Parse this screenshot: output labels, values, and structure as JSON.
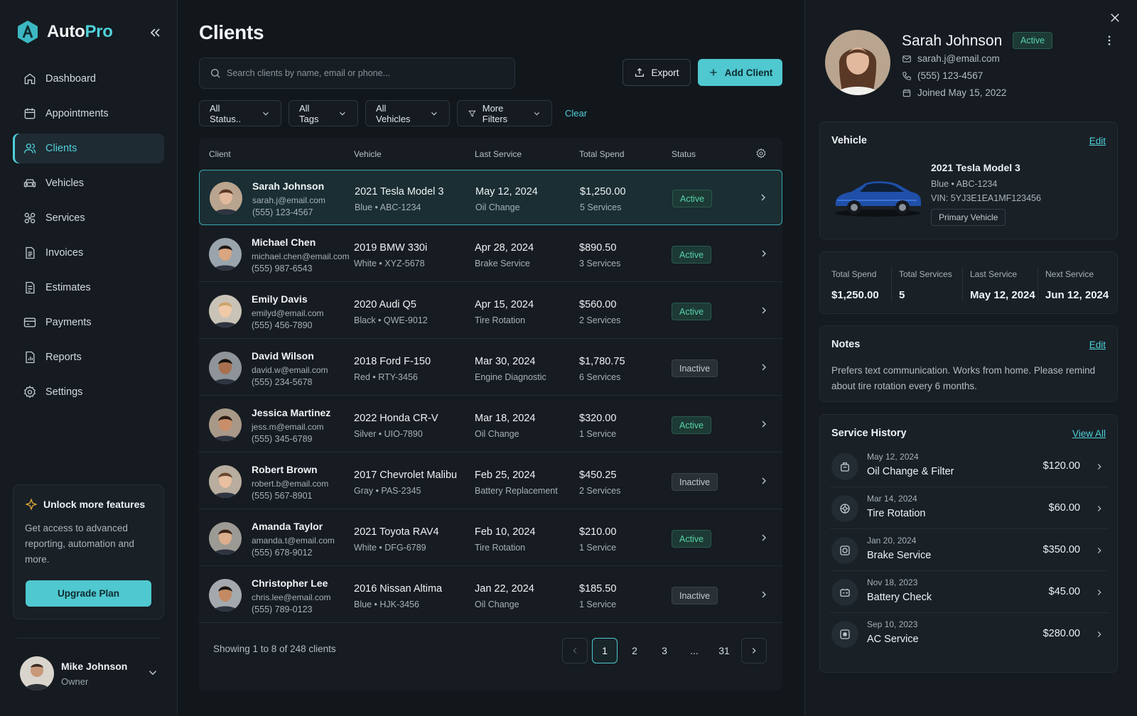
{
  "app": {
    "name_main": "Auto",
    "name_accent": "Pro"
  },
  "nav": [
    {
      "label": "Dashboard",
      "icon": "home-icon",
      "active": false
    },
    {
      "label": "Appointments",
      "icon": "calendar-icon",
      "active": false
    },
    {
      "label": "Clients",
      "icon": "users-icon",
      "active": true
    },
    {
      "label": "Vehicles",
      "icon": "car-icon",
      "active": false
    },
    {
      "label": "Services",
      "icon": "services-icon",
      "active": false
    },
    {
      "label": "Invoices",
      "icon": "invoice-icon",
      "active": false
    },
    {
      "label": "Estimates",
      "icon": "estimate-icon",
      "active": false
    },
    {
      "label": "Payments",
      "icon": "payment-icon",
      "active": false
    },
    {
      "label": "Reports",
      "icon": "report-icon",
      "active": false
    },
    {
      "label": "Settings",
      "icon": "gear-icon",
      "active": false
    }
  ],
  "upgrade": {
    "title": "Unlock more features",
    "description": "Get access to advanced reporting, automation and more.",
    "button": "Upgrade Plan"
  },
  "user": {
    "name": "Mike Johnson",
    "role": "Owner"
  },
  "page": {
    "title": "Clients"
  },
  "search": {
    "placeholder": "Search clients by name, email or phone..."
  },
  "actions": {
    "export": "Export",
    "add": "Add Client"
  },
  "filters": {
    "status": "All Status..",
    "tags": "All Tags",
    "vehicles": "All Vehicles",
    "more": "More Filters",
    "clear": "Clear"
  },
  "table": {
    "columns": {
      "client": "Client",
      "vehicle": "Vehicle",
      "last_service": "Last Service",
      "total_spend": "Total Spend",
      "status": "Status"
    },
    "rows": [
      {
        "name": "Sarah Johnson",
        "email": "sarah.j@email.com",
        "phone": "(555) 123-4567",
        "vehicle": "2021 Tesla Model 3",
        "color": "Blue",
        "plate": "ABC-1234",
        "last_date": "May 12, 2024",
        "last_type": "Oil Change",
        "spend": "$1,250.00",
        "services": "5 Services",
        "status": "Active"
      },
      {
        "name": "Michael Chen",
        "email": "michael.chen@email.com",
        "phone": "(555) 987-6543",
        "vehicle": "2019 BMW 330i",
        "color": "White",
        "plate": "XYZ-5678",
        "last_date": "Apr 28, 2024",
        "last_type": "Brake Service",
        "spend": "$890.50",
        "services": "3 Services",
        "status": "Active"
      },
      {
        "name": "Emily Davis",
        "email": "emilyd@email.com",
        "phone": "(555) 456-7890",
        "vehicle": "2020 Audi Q5",
        "color": "Black",
        "plate": "QWE-9012",
        "last_date": "Apr 15, 2024",
        "last_type": "Tire Rotation",
        "spend": "$560.00",
        "services": "2 Services",
        "status": "Active"
      },
      {
        "name": "David Wilson",
        "email": "david.w@email.com",
        "phone": "(555) 234-5678",
        "vehicle": "2018 Ford F-150",
        "color": "Red",
        "plate": "RTY-3456",
        "last_date": "Mar 30, 2024",
        "last_type": "Engine Diagnostic",
        "spend": "$1,780.75",
        "services": "6 Services",
        "status": "Inactive"
      },
      {
        "name": "Jessica Martinez",
        "email": "jess.m@email.com",
        "phone": "(555) 345-6789",
        "vehicle": "2022 Honda CR-V",
        "color": "Silver",
        "plate": "UIO-7890",
        "last_date": "Mar 18, 2024",
        "last_type": "Oil Change",
        "spend": "$320.00",
        "services": "1 Service",
        "status": "Active"
      },
      {
        "name": "Robert Brown",
        "email": "robert.b@email.com",
        "phone": "(555) 567-8901",
        "vehicle": "2017 Chevrolet Malibu",
        "color": "Gray",
        "plate": "PAS-2345",
        "last_date": "Feb 25, 2024",
        "last_type": "Battery Replacement",
        "spend": "$450.25",
        "services": "2 Services",
        "status": "Inactive"
      },
      {
        "name": "Amanda Taylor",
        "email": "amanda.t@email.com",
        "phone": "(555) 678-9012",
        "vehicle": "2021 Toyota RAV4",
        "color": "White",
        "plate": "DFG-6789",
        "last_date": "Feb 10, 2024",
        "last_type": "Tire Rotation",
        "spend": "$210.00",
        "services": "1 Service",
        "status": "Active"
      },
      {
        "name": "Christopher Lee",
        "email": "chris.lee@email.com",
        "phone": "(555) 789-0123",
        "vehicle": "2016 Nissan Altima",
        "color": "Blue",
        "plate": "HJK-3456",
        "last_date": "Jan 22, 2024",
        "last_type": "Oil Change",
        "spend": "$185.50",
        "services": "1 Service",
        "status": "Inactive"
      }
    ],
    "footer": "Showing 1 to 8 of 248 clients",
    "pages": [
      "1",
      "2",
      "3",
      "...",
      "31"
    ]
  },
  "panel": {
    "name": "Sarah Johnson",
    "status": "Active",
    "email": "sarah.j@email.com",
    "phone": "(555) 123-4567",
    "joined": "Joined May 15, 2022",
    "vehicle": {
      "title": "Vehicle",
      "edit": "Edit",
      "model": "2021 Tesla Model 3",
      "sub": "Blue  •  ABC-1234",
      "vin": "VIN: 5YJ3E1EA1MF123456",
      "tag": "Primary Vehicle"
    },
    "stats": [
      {
        "label": "Total Spend",
        "value": "$1,250.00"
      },
      {
        "label": "Total Services",
        "value": "5"
      },
      {
        "label": "Last Service",
        "value": "May 12, 2024"
      },
      {
        "label": "Next Service",
        "value": "Jun 12, 2024"
      }
    ],
    "notes": {
      "title": "Notes",
      "edit": "Edit",
      "text": "Prefers text communication. Works from home. Please remind about tire rotation every 6 months."
    },
    "history": {
      "title": "Service History",
      "view_all": "View All",
      "items": [
        {
          "date": "May 12, 2024",
          "name": "Oil Change & Filter",
          "amount": "$120.00"
        },
        {
          "date": "Mar 14, 2024",
          "name": "Tire Rotation",
          "amount": "$60.00"
        },
        {
          "date": "Jan 20, 2024",
          "name": "Brake Service",
          "amount": "$350.00"
        },
        {
          "date": "Nov 18, 2023",
          "name": "Battery Check",
          "amount": "$45.00"
        },
        {
          "date": "Sep 10, 2023",
          "name": "AC Service",
          "amount": "$280.00"
        }
      ]
    }
  },
  "colors": {
    "accent": "#4fd1d9",
    "active": "#56d3a8",
    "background": "#12171c"
  }
}
